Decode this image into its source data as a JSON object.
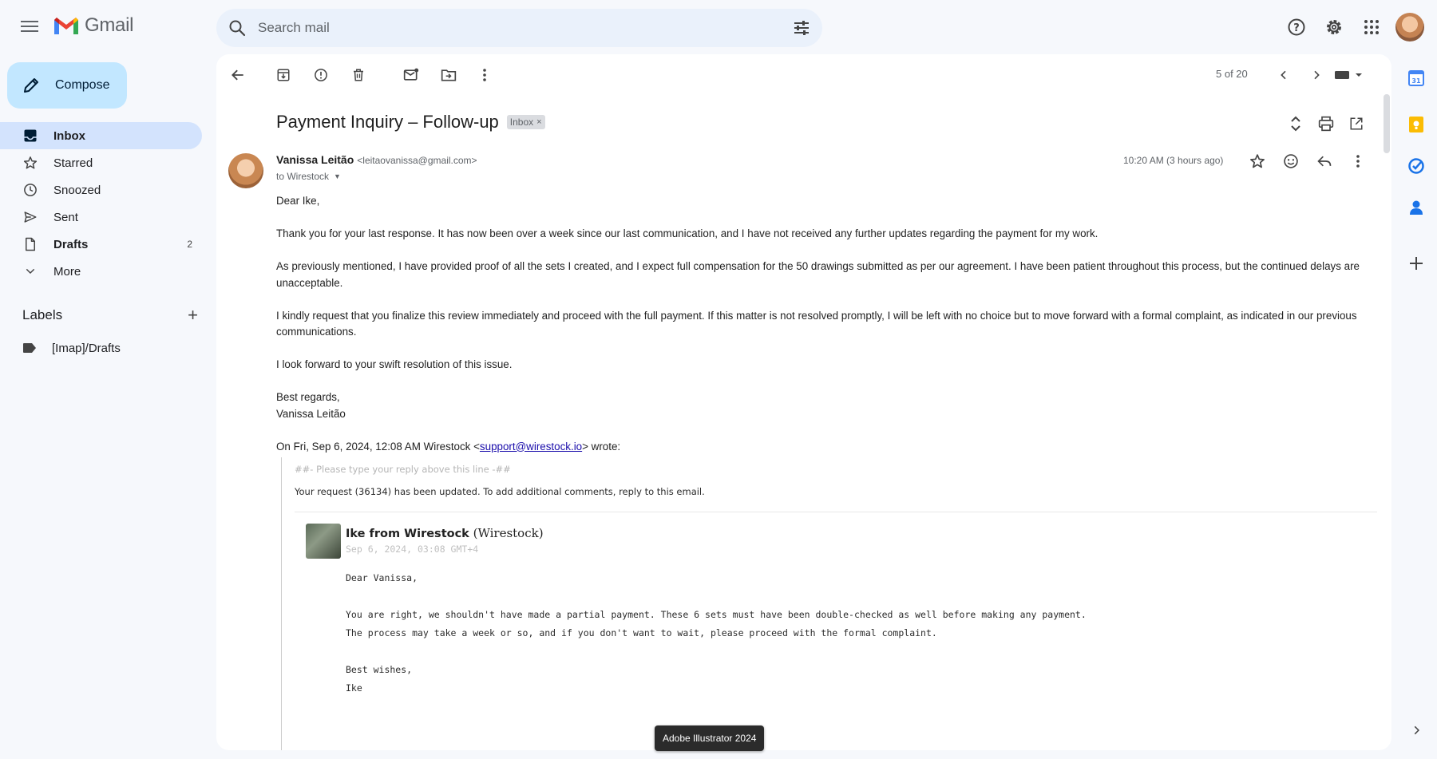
{
  "app": {
    "name": "Gmail"
  },
  "search": {
    "placeholder": "Search mail"
  },
  "compose_label": "Compose",
  "nav": [
    {
      "label": "Inbox",
      "count": ""
    },
    {
      "label": "Starred",
      "count": ""
    },
    {
      "label": "Snoozed",
      "count": ""
    },
    {
      "label": "Sent",
      "count": ""
    },
    {
      "label": "Drafts",
      "count": "2"
    },
    {
      "label": "More",
      "count": ""
    }
  ],
  "labels": {
    "title": "Labels",
    "items": [
      "[Imap]/Drafts"
    ]
  },
  "pager": "5 of 20",
  "email": {
    "subject": "Payment Inquiry – Follow-up",
    "chip": "Inbox",
    "chip_close": "×",
    "sender_name": "Vanissa Leitão",
    "sender_email": "<leitaovanissa@gmail.com>",
    "to": "to Wirestock",
    "time": "10:20 AM (3 hours ago)",
    "body": {
      "greeting": "Dear Ike,",
      "p1": "Thank you for your last response. It has now been over a week since our last communication, and I have not received any further updates regarding the payment for my work.",
      "p2": "As previously mentioned, I have provided proof of all the sets I created, and I expect full compensation for the 50 drawings submitted as per our agreement. I have been patient throughout this process, but the continued delays are unacceptable.",
      "p3": "I kindly request that you finalize this review immediately and proceed with the full payment. If this matter is not resolved promptly, I will be left with no choice but to move forward with a formal complaint, as indicated in our previous communications.",
      "p4": "I look forward to your swift resolution of this issue.",
      "sign1": "Best regards,",
      "sign2": "Vanissa Leitão",
      "wrote_prefix": "On Fri, Sep 6, 2024, 12:08 AM Wirestock <",
      "wrote_link": "support@wirestock.io",
      "wrote_suffix": "> wrote:"
    },
    "quote": {
      "separator": "##- Please type your reply above this line -##",
      "request": "Your request (36134) has been updated. To add additional comments, reply to this email.",
      "author_name": "Ike from Wirestock",
      "author_org": "(Wirestock)",
      "date": "Sep 6, 2024, 03:08 GMT+4",
      "greeting": "Dear Vanissa,",
      "line1": "You are right, we shouldn't have made a partial payment. These 6 sets must have been double-checked as well before making any payment.",
      "line2": "The process may take a week or so, and if you don't want to wait, please proceed with the formal complaint.",
      "sign1": "Best wishes,",
      "sign2": "Ike"
    }
  },
  "tooltip": "Adobe Illustrator 2024",
  "colors": {
    "accent": "#0b57d0",
    "compose_bg": "#c2e7ff",
    "active_nav": "#d3e3fd",
    "search_bg": "#eaf1fb"
  }
}
